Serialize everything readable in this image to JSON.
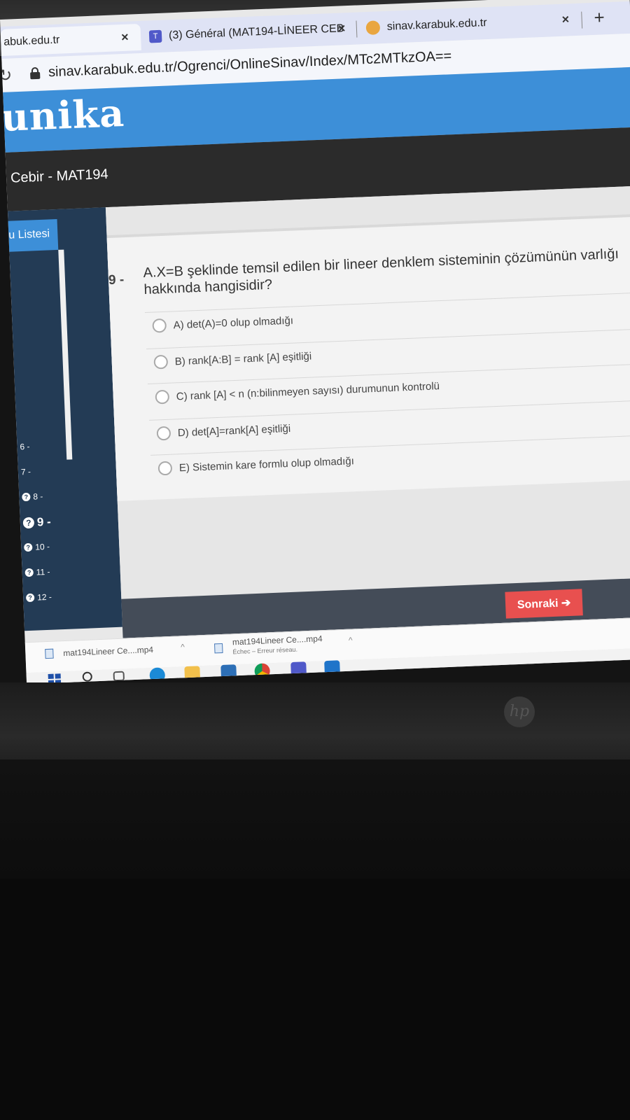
{
  "browser": {
    "tabs": [
      {
        "title": "abuk.edu.tr",
        "active": true
      },
      {
        "title": "(3) Général (MAT194-LİNEER CEB",
        "active": false
      },
      {
        "title": "sinav.karabuk.edu.tr",
        "active": false
      }
    ],
    "tab_close_glyph": "×",
    "new_tab_glyph": "+",
    "url": "sinav.karabuk.edu.tr/Ogrenci/OnlineSinav/Index/MTc2MTkzOA=="
  },
  "site": {
    "logo": "unika",
    "course": "Cebir - MAT194"
  },
  "sidebar": {
    "heading": "u Listesi",
    "questions": [
      "6 -",
      "7 -",
      "8 -",
      "9 -",
      "10 -",
      "11 -",
      "12 -"
    ],
    "current": "9 -"
  },
  "question": {
    "number": "9 -",
    "text": "A.X=B şeklinde temsil edilen bir lineer denklem sisteminin çözümünün varlığı hakkında hangisidir?",
    "options": [
      "A)  det(A)=0 olup olmadığı",
      "B)  rank[A:B] = rank [A] eşitliği",
      "C)  rank [A] < n (n:bilinmeyen sayısı) durumunun kontrolü",
      "D)  det[A]=rank[A] eşitliği",
      "E)  Sistemin kare formlu olup olmadığı"
    ]
  },
  "navigation": {
    "next_label": "Sonraki ➔"
  },
  "downloads": [
    {
      "name": "mat194Lineer Ce....mp4",
      "status": ""
    },
    {
      "name": "mat194Lineer Ce....mp4",
      "status": "Échec – Erreur réseau."
    }
  ],
  "device": {
    "brand": "hp"
  },
  "colors": {
    "accent": "#3d8fd8",
    "sidebar": "#233b55",
    "next_button": "#e8504f"
  }
}
